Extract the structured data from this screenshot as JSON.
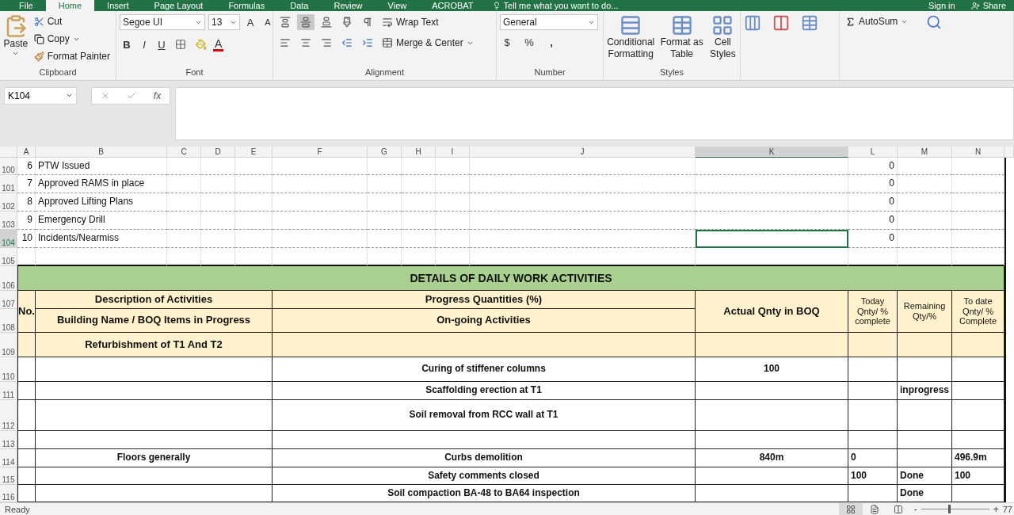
{
  "tabs": [
    {
      "label": "File",
      "selected": false
    },
    {
      "label": "Home",
      "selected": true
    },
    {
      "label": "Insert",
      "selected": false
    },
    {
      "label": "Page Layout",
      "selected": false
    },
    {
      "label": "Formulas",
      "selected": false
    },
    {
      "label": "Data",
      "selected": false
    },
    {
      "label": "Review",
      "selected": false
    },
    {
      "label": "View",
      "selected": false
    },
    {
      "label": "ACROBAT",
      "selected": false
    }
  ],
  "tell_me": "Tell me what you want to do...",
  "account": {
    "sign_in": "Sign in",
    "share": "Share"
  },
  "clipboard": {
    "paste": "Paste",
    "cut": "Cut",
    "copy": "Copy",
    "format_painter": "Format Painter",
    "label": "Clipboard"
  },
  "font": {
    "name": "Segoe UI",
    "size": "13",
    "grow": "A",
    "shrink": "A",
    "bold": "B",
    "italic": "I",
    "underline": "U",
    "color_letter": "A",
    "label": "Font"
  },
  "alignment": {
    "vertical": [
      {
        "selected": false
      },
      {
        "selected": true
      },
      {
        "selected": false
      }
    ],
    "wrap_text": "Wrap Text",
    "merge": "Merge & Center",
    "label": "Alignment"
  },
  "number": {
    "format": "General",
    "currency": "$",
    "percent": "%",
    "comma": ",",
    "label": "Number"
  },
  "styles": {
    "buttons": [
      "Conditional Formatting",
      "Format as Table",
      "Cell Styles"
    ],
    "label": "Styles"
  },
  "editing": {
    "autosum": "AutoSum"
  },
  "formula_bar": {
    "name_box": "K104",
    "fx": "fx"
  },
  "columns": [
    {
      "label": "A",
      "selected": false
    },
    {
      "label": "B",
      "selected": false
    },
    {
      "label": "C",
      "selected": false
    },
    {
      "label": "D",
      "selected": false
    },
    {
      "label": "E",
      "selected": false
    },
    {
      "label": "F",
      "selected": false
    },
    {
      "label": "G",
      "selected": false
    },
    {
      "label": "H",
      "selected": false
    },
    {
      "label": "I",
      "selected": false
    },
    {
      "label": "J",
      "selected": false
    },
    {
      "label": "K",
      "selected": true
    },
    {
      "label": "L",
      "selected": false
    },
    {
      "label": "M",
      "selected": false
    },
    {
      "label": "N",
      "selected": false
    }
  ],
  "upper_rows": [
    {
      "number": "100",
      "selected": false,
      "no": "6",
      "item": "PTW Issued",
      "value": "0"
    },
    {
      "number": "101",
      "selected": false,
      "no": "7",
      "item": "Approved RAMS in place",
      "value": "0"
    },
    {
      "number": "102",
      "selected": false,
      "no": "8",
      "item": "Approved Lifting Plans",
      "value": "0"
    },
    {
      "number": "103",
      "selected": false,
      "no": "9",
      "item": "Emergency Drill",
      "value": "0"
    },
    {
      "number": "104",
      "selected": true,
      "no": "10",
      "item": "Incidents/Nearmiss",
      "value": "0"
    },
    {
      "number": "105",
      "selected": false
    }
  ],
  "report": {
    "title_row": {
      "number": "106",
      "selected": false
    },
    "title": "DETAILS OF DAILY WORK ACTIVITIES",
    "header_rows": [
      {
        "number": "107",
        "selected": false
      },
      {
        "number": "108",
        "selected": false
      },
      {
        "number": "109",
        "selected": false
      }
    ],
    "no": "No.",
    "description": "Description of Activities",
    "progress": "Progress Quantities (%)",
    "building": "Building Name / BOQ Items in Progress",
    "ongoing": "On-going Activities",
    "project": "Refurbishment of T1 And T2",
    "actual": "Actual Qnty in BOQ",
    "today": "Today Qnty/ % complete",
    "remaining": "Remaining Qty/%",
    "to_date": "To date Qnty/ % Complete",
    "rows": [
      {
        "number": "110",
        "selected": false,
        "activity": "Curing of stiffener columns",
        "actual": "100"
      },
      {
        "number": "111",
        "selected": false,
        "activity": "Scaffolding erection at T1",
        "remaining": "inprogress"
      },
      {
        "number": "112",
        "selected": false,
        "activity": "Soil removal from RCC wall at T1"
      },
      {
        "number": "113",
        "selected": false
      },
      {
        "number": "114",
        "selected": false,
        "description": "Floors generally",
        "activity": "Curbs demolition",
        "actual": "840m",
        "today": "0",
        "to_date": "496.9m"
      },
      {
        "number": "115",
        "selected": false,
        "activity": "Safety comments closed",
        "today": "100",
        "remaining": "Done",
        "to_date": "100"
      },
      {
        "number": "116",
        "selected": false,
        "activity": "Soil compaction BA-48 to BA64 inspection",
        "remaining": "Done"
      }
    ]
  },
  "status": {
    "text": "Ready",
    "zoom": {
      "level": 0.4
    },
    "minus": "-",
    "plus": "+",
    "zoom_reading": "77"
  }
}
